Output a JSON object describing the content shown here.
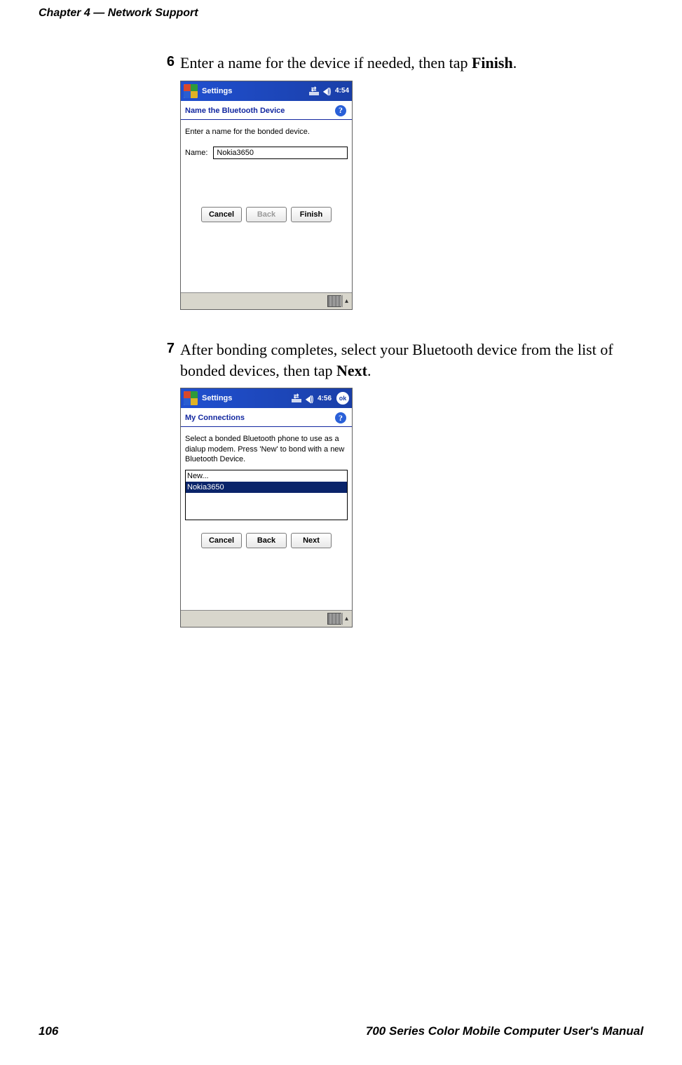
{
  "header": {
    "chapter": "Chapter 4",
    "separator": "  —  ",
    "title": "Network Support"
  },
  "footer": {
    "page": "106",
    "manual": "700 Series Color Mobile Computer User's Manual"
  },
  "steps": [
    {
      "num": "6",
      "text_before": "Enter a name for the device if needed, then tap ",
      "text_bold": "Finish",
      "text_after": "."
    },
    {
      "num": "7",
      "text_before": "After bonding completes, select your Bluetooth device from the list of bonded devices, then tap ",
      "text_bold": "Next",
      "text_after": "."
    }
  ],
  "shot1": {
    "top_title": "Settings",
    "time": "4:54",
    "caption": "Name the Bluetooth Device",
    "instruction": "Enter a name for the bonded device.",
    "label_name": "Name:",
    "name_value": "Nokia3650",
    "cancel": "Cancel",
    "back": "Back",
    "finish": "Finish"
  },
  "shot2": {
    "top_title": "Settings",
    "time": "4:56",
    "caption": "My Connections",
    "instruction": "Select a bonded Bluetooth phone to use as a dialup modem. Press 'New' to bond with a new Bluetooth Device.",
    "items": [
      "New...",
      "Nokia3650"
    ],
    "cancel": "Cancel",
    "back": "Back",
    "next": "Next",
    "ok": "ok"
  }
}
